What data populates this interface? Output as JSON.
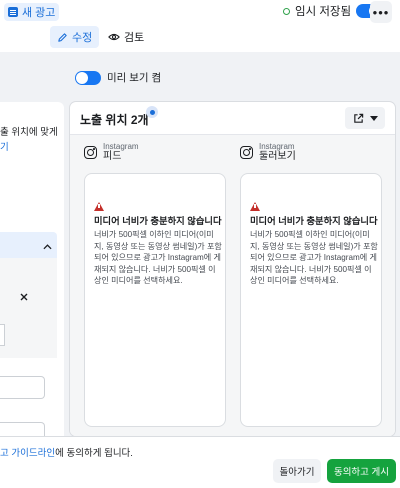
{
  "header": {
    "new_ad_label": "새 광고",
    "draft_label": "임시 저장됨",
    "more_label": "•••"
  },
  "modes": {
    "edit_label": "수정",
    "review_label": "검토"
  },
  "left_panel": {
    "text_fragment": "출 위치에 맞게",
    "link_fragment": "기"
  },
  "preview_toggle_label": "미리 보기 켬",
  "placements": {
    "title": "노출 위치 2개",
    "columns": [
      {
        "brand": "Instagram",
        "label": "피드",
        "warning_title": "미디어 너비가 충분하지 않습니다",
        "warning_body": "너비가 500픽셀 이하인 미디어(이미지, 동영상 또는 동영상 썸네일)가 포함되어 있으므로 광고가 Instagram에 게재되지 않습니다. 너비가 500픽셀 이상인 미디어를 선택하세요."
      },
      {
        "brand": "Instagram",
        "label": "둘러보기",
        "warning_title": "미디어 너비가 충분하지 않습니다",
        "warning_body": "너비가 500픽셀 이하인 미디어(이미지, 동영상 또는 동영상 썸네일)가 포함되어 있으므로 광고가 Instagram에 게재되지 않습니다. 너비가 500픽셀 이상인 미디어를 선택하세요."
      }
    ]
  },
  "footer": {
    "agreement_link": "고 가이드라인",
    "agreement_suffix": "에 동의하게 됩니다.",
    "back_label": "돌아가기",
    "publish_label": "동의하고 게시"
  },
  "colors": {
    "accent": "#1a6ed8",
    "publish": "#15a33e",
    "warning": "#c4302b"
  }
}
